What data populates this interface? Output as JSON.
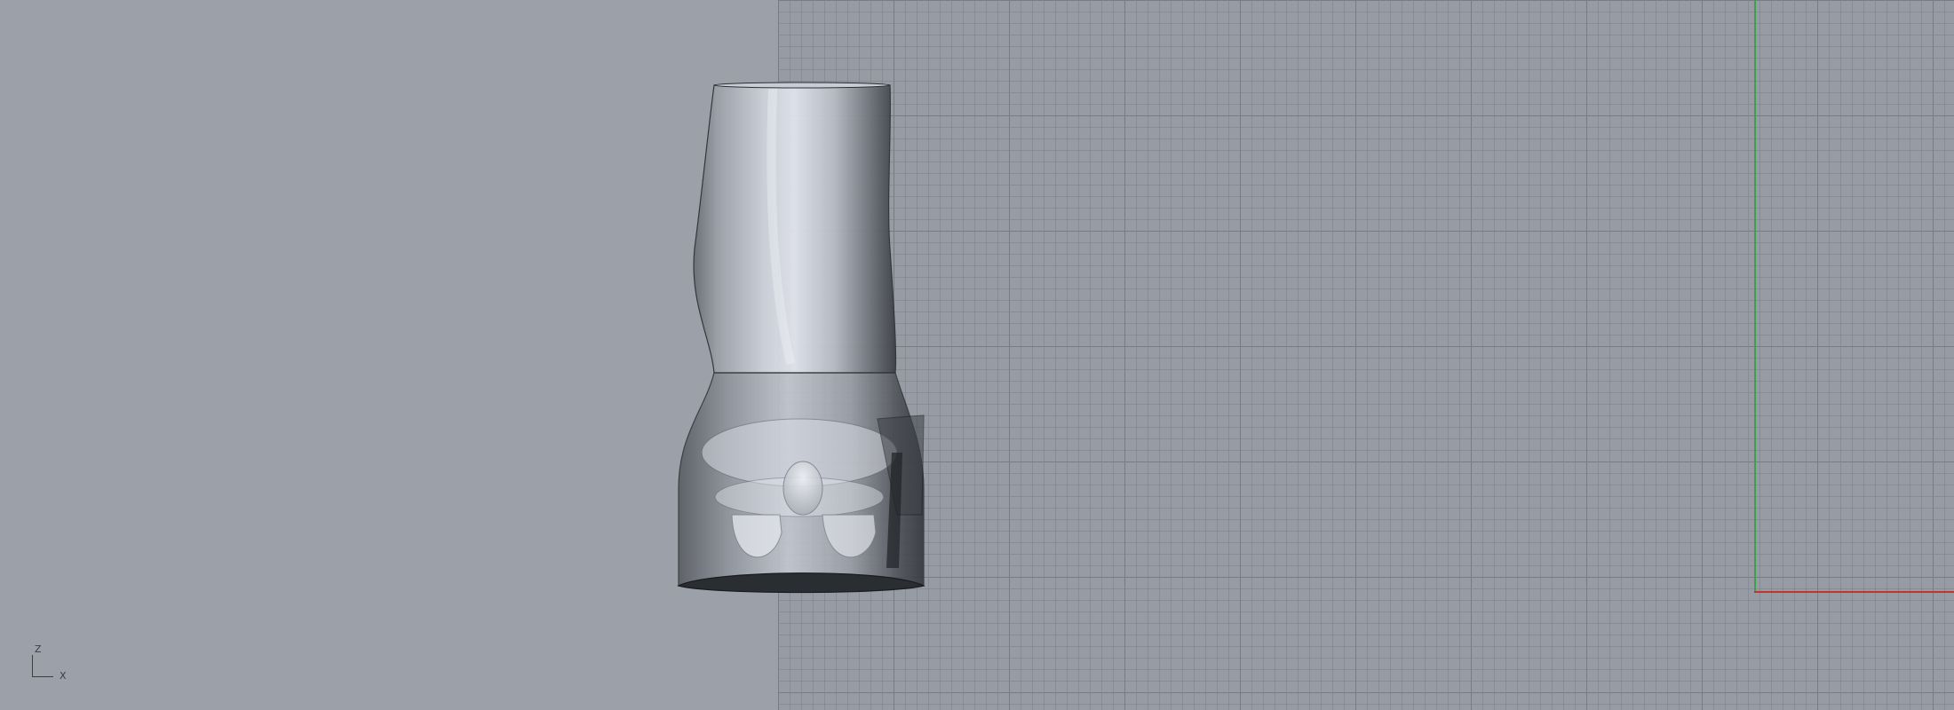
{
  "viewport": {
    "background_color": "#9ca1a9",
    "grid_color": "#7c8189",
    "axis_colors": {
      "x": "#c4342e",
      "y": "#3fa04a"
    }
  },
  "axis_gizmo": {
    "vertical_label": "Z",
    "horizontal_label": "X"
  },
  "object": {
    "type": "translucent-shoe-last-model",
    "color": "#d9dde6"
  }
}
